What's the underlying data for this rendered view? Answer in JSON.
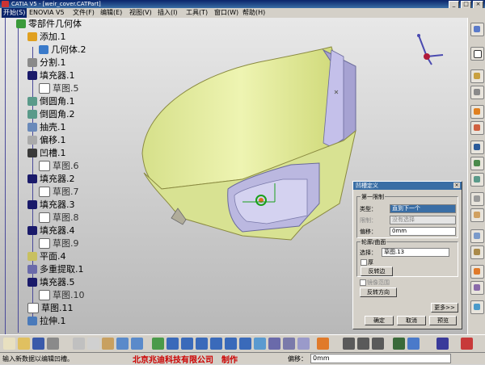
{
  "window": {
    "title": "CATIA V5 - [weir_cover.CATPart]",
    "buttons": [
      "_",
      "□",
      "×"
    ]
  },
  "menu": [
    "开始(S)",
    "ENOVIA V5",
    "文件(F)",
    "编辑(E)",
    "视图(V)",
    "插入(I)",
    "工具(T)",
    "窗口(W)",
    "帮助(H)"
  ],
  "tree": [
    {
      "label": "零部件几何体",
      "icon": "body-icon"
    },
    {
      "label": "添加.1",
      "icon": "add-icon"
    },
    {
      "label": "几何体.2",
      "icon": "body-icon"
    },
    {
      "label": "分割.1",
      "icon": "split-icon"
    },
    {
      "label": "填充器.1",
      "icon": "pad-icon"
    },
    {
      "label": "草图.5",
      "icon": "sketch-icon"
    },
    {
      "label": "倒圆角.1",
      "icon": "fillet-icon"
    },
    {
      "label": "倒圆角.2",
      "icon": "fillet-icon"
    },
    {
      "label": "抽壳.1",
      "icon": "shell-icon"
    },
    {
      "label": "偏移.1",
      "icon": "offset-icon"
    },
    {
      "label": "凹槽.1",
      "icon": "pocket-icon"
    },
    {
      "label": "草图.6",
      "icon": "sketch-icon"
    },
    {
      "label": "填充器.2",
      "icon": "pad-icon"
    },
    {
      "label": "草图.7",
      "icon": "sketch-icon"
    },
    {
      "label": "填充器.3",
      "icon": "pad-icon"
    },
    {
      "label": "草图.8",
      "icon": "sketch-icon"
    },
    {
      "label": "填充器.4",
      "icon": "pad-icon"
    },
    {
      "label": "草图.9",
      "icon": "sketch-icon"
    },
    {
      "label": "平面.4",
      "icon": "plane-icon"
    },
    {
      "label": "多重提取.1",
      "icon": "extract-icon"
    },
    {
      "label": "填充器.5",
      "icon": "pad-icon"
    },
    {
      "label": "草图.10",
      "icon": "sketch-icon"
    },
    {
      "label": "草图.11",
      "icon": "sketch-icon"
    },
    {
      "label": "拉伸.1",
      "icon": "extrude-icon"
    }
  ],
  "dialog": {
    "title": "凹槽定义",
    "group1": "第一限制",
    "type_label": "类型：",
    "type_value": "直到下一个",
    "limit_label": "限制：",
    "limit_value": "没有选择",
    "offset_label": "偏移：",
    "offset_value": "0mm",
    "group2": "轮廓/曲面",
    "select_label": "选择：",
    "select_value": "草图.13",
    "thick_label": "厚",
    "reverse_side": "反转边",
    "mirror_label": "镜像范围",
    "reverse_dir": "反转方向",
    "more": "更多>>",
    "ok": "确定",
    "cancel": "取消",
    "preview": "预览"
  },
  "status": {
    "message": "输入新数据以编辑凹槽。",
    "credit": "北京兆迪科技有限公司　制作",
    "offset_label": "偏移：",
    "offset_value": "0mm"
  },
  "colors": {
    "body": "#e6ef9a",
    "shade": "#b9b6dc",
    "tree_line": "#4a4a9a",
    "dialog_title": "#3a6ea5"
  }
}
